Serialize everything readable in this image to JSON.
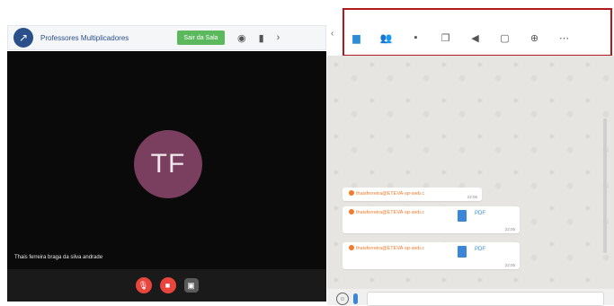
{
  "meeting": {
    "title": "Professores Multiplicadores",
    "leave_label": "Sair da Sala",
    "participant": {
      "initials": "TF",
      "name": "Thais ferreira braga da silva andrade"
    }
  },
  "colors": {
    "accent_green": "#5cb85c",
    "avatar": "#7a3e5f",
    "chat_sender": "#f07b2b",
    "highlight": "#b11a1a",
    "pdf_blue": "#3a86d8"
  },
  "chat": {
    "messages": [
      {
        "sender": "thaisferreira@ETEVA-sp-web.c",
        "time": "22:06"
      },
      {
        "sender": "thaisferreira@ETEVA-sp-web.c",
        "attachment": "PDF",
        "time": "22:06"
      },
      {
        "sender": "thaisferreira@ETEVA-sp-web.c",
        "attachment": "PDF",
        "time": "22:06"
      }
    ]
  }
}
